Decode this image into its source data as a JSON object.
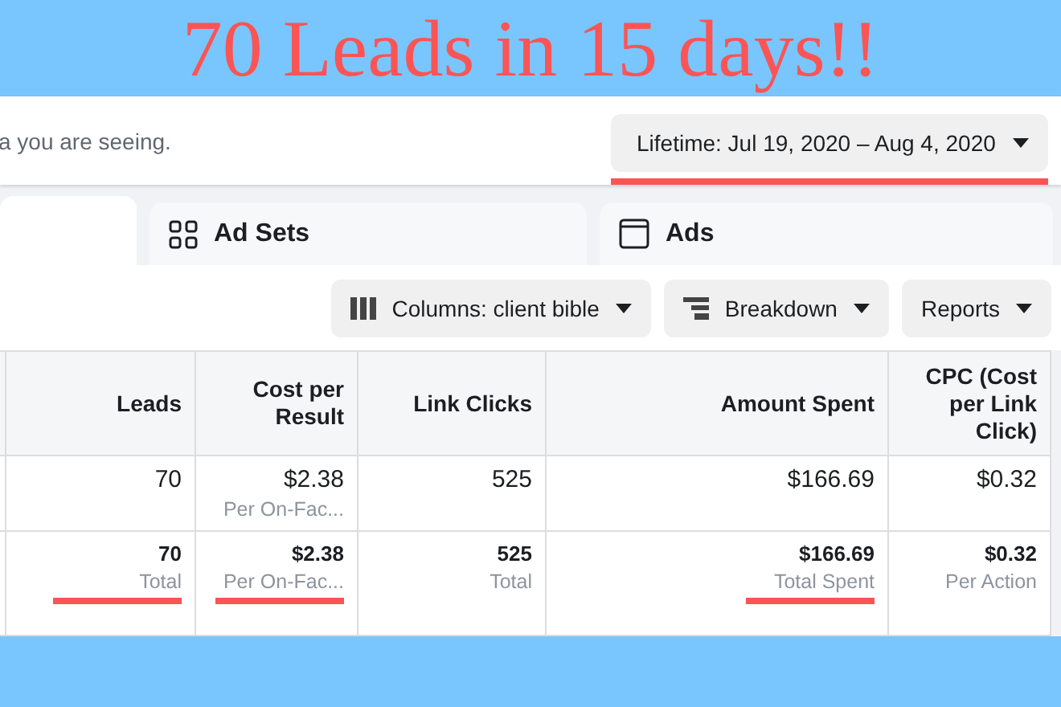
{
  "headline": "70 Leads in 15 days!!",
  "notice": "a you are seeing.",
  "date_range": {
    "label": "Lifetime: Jul 19, 2020 – Aug 4, 2020",
    "underlined": true
  },
  "tabs": [
    {
      "kind": "blank",
      "selected": true
    },
    {
      "label": "Ad Sets",
      "kind": "adsets",
      "selected": false
    },
    {
      "label": "Ads",
      "kind": "ads",
      "selected": false
    }
  ],
  "toolbar": [
    {
      "label": "Columns: client bible",
      "kind": "columns"
    },
    {
      "label": "Breakdown",
      "kind": "breakdown"
    },
    {
      "label": "Reports",
      "kind": "reports"
    }
  ],
  "table": {
    "columns": [
      "Leads",
      "Cost per Result",
      "Link Clicks",
      "Amount Spent",
      "CPC (Cost per Link Click)"
    ],
    "rows": [
      {
        "total": false,
        "cells": [
          {
            "value": "70"
          },
          {
            "value": "$2.38",
            "sub": "Per On-Fac..."
          },
          {
            "value": "525"
          },
          {
            "value": "$166.69"
          },
          {
            "value": "$0.32"
          }
        ]
      },
      {
        "total": true,
        "cells": [
          {
            "value": "70",
            "sub": "Total",
            "underlined": true
          },
          {
            "value": "$2.38",
            "sub": "Per On-Fac...",
            "underlined": true
          },
          {
            "value": "525",
            "sub": "Total",
            "underlined": false
          },
          {
            "value": "$166.69",
            "sub": "Total Spent",
            "underlined": true
          },
          {
            "value": "$0.32",
            "sub": "Per Action",
            "underlined": false
          }
        ]
      }
    ]
  }
}
